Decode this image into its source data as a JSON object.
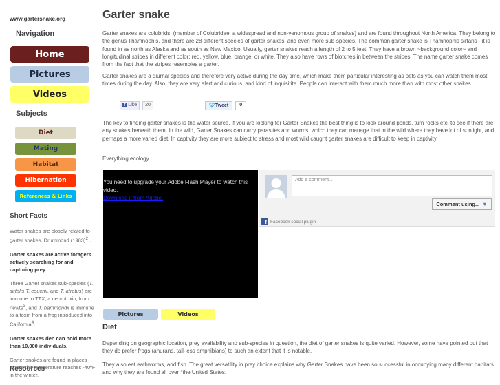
{
  "sidebar": {
    "site": "www.gartersnake.org",
    "navigation_heading": "Navigation",
    "nav": [
      {
        "label": "Home",
        "bg": "#6b1f1f",
        "color": "#ffffff"
      },
      {
        "label": "Pictures",
        "bg": "#b8cce4",
        "color": "#1f2a44"
      },
      {
        "label": "Videos",
        "bg": "#ffff66",
        "color": "#222222"
      }
    ],
    "subjects_heading": "Subjects",
    "subjects": [
      {
        "label": "Diet",
        "bg": "#ddd9c3",
        "color": "#632523"
      },
      {
        "label": "Mating",
        "bg": "#77933c",
        "color": "#1f3864"
      },
      {
        "label": "Habitat",
        "bg": "#f79646",
        "color": "#5a2a0a"
      },
      {
        "label": "Hibernation",
        "bg": "#ff3300",
        "color": "#ffffff"
      },
      {
        "label": "References & Links",
        "bg": "#00b0f0",
        "color": "#ffff00"
      }
    ],
    "short_facts_heading": "Short Facts",
    "facts": {
      "f1": "Water snakes are closely related to garter snakes. Drummond (1983)",
      "f1_sup": "2",
      "f2": "Garter snakes are active foragers actively searching for and capturing prey.",
      "f3a": "Three Garter snakes sub-species (",
      "f3b": "T. sirtalis",
      "f3c": ",",
      "f3d": "T. couchii",
      "f3e": ", and ",
      "f3f": "T. atratus",
      "f3g": ") are immune to TTX, a neurotoxin, from newts",
      "f3h": "3",
      "f3i": ", and ",
      "f3j": "T. hammondii",
      "f3k": " is immune to a toxin from a frog introduced into California",
      "f3l": "4",
      "f3m": ".",
      "f4": "Garter snakes den can hold more than 10,000 individuals.",
      "f5": "Garter snakes are found in places where the temperature reaches -40ºF in the winter."
    },
    "resources_heading": "Resources"
  },
  "main": {
    "title": "Garter snake",
    "p1": "Garter snakes are colubrids, (member of Colubridae, a widespread and non-venomous group of snakes) and are found throughout North America. They belong to the genus Thamnophis, and there are 28 different species of garter snakes, and even more sub-species. The common garter snake is Thamnophis sirtaris - it is found in as north as Alaska and as south as New Mexico. Usually, garter snakes reach a length of 2 to 5 feet. They have a brown ~background color~ and longitudinal stripes in different color: red, yellow, blue, orange, or white. They also have rows of blotches in between the stripes. The name garter snake comes from the fact that the stripes resembles a garter.",
    "p2": "Garter snakes are a diurnal species and therefore very active during the day time, which make them particular interesting as pets as you can watch them most times during the day. Also, they are very alert and curious, and kind of inquisitite. People can interact with them much more than with most other snakes.",
    "like_label": "Like",
    "like_count": "20",
    "tweet_label": "Tweet",
    "tweet_count": "0",
    "p3": "The key to finding garter snakes is the water source. If you are looking for Garter Snakes the best thing is to look around ponds, turn rocks etc. to see if there are any snakes beneath them. In the wild, Garter Snakes can carry parasites and worms, which they can manage that in the wild where they have lot of sunlight, and perhaps a more varied diet. In captivity they are more subject to stress and most wild caught garter snakes are difficult to keep in captivity.",
    "p4": "Everything ecology",
    "video_msg": "You need to upgrade your Adobe Flash Player to watch this video.",
    "video_link": "Download it from Adobe.",
    "comment_placeholder": "Add a comment...",
    "comment_using": "Comment using...",
    "fb_plugin": "Facebook social plugin",
    "btn_pictures": "Pictures",
    "btn_videos": "Videos",
    "diet_heading": "Diet",
    "p5": "Depending on geographic location, prey availability and sub-species in question, the diet of garter snakes is quite varied. However, some have pointed out that they do prefer frogs (anurans, tail-less amphibians) to such an extent that it is notable.",
    "p6": "They also eat eathworms, and fish. The great versatility in prey choice explains why Garter Snakes have been so successful in occupying many different habitats and why they are found all over *the United States."
  }
}
